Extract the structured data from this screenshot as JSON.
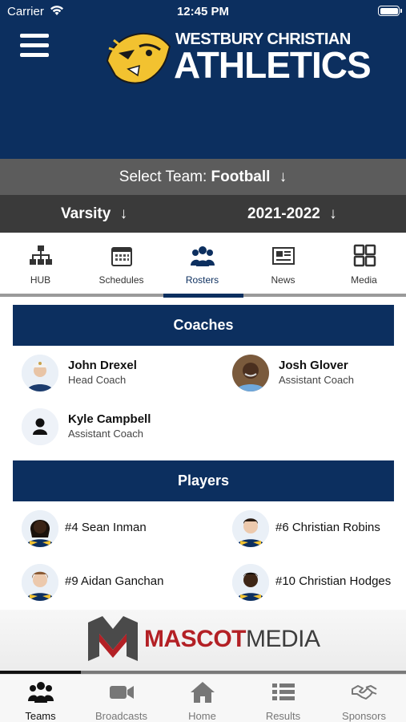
{
  "status_bar": {
    "carrier": "Carrier",
    "time": "12:45 PM"
  },
  "brand": {
    "line1": "WESTBURY CHRISTIAN",
    "line2": "ATHLETICS"
  },
  "team_select": {
    "label": "Select Team:",
    "value": "Football",
    "arrow": "↓"
  },
  "level_select": {
    "level": "Varsity",
    "season": "2021-2022",
    "arrow": "↓"
  },
  "subnav": {
    "active": "Rosters",
    "items": [
      {
        "label": "HUB",
        "icon": "org-chart-icon"
      },
      {
        "label": "Schedules",
        "icon": "calendar-icon"
      },
      {
        "label": "Rosters",
        "icon": "people-group-icon"
      },
      {
        "label": "News",
        "icon": "newspaper-icon"
      },
      {
        "label": "Media",
        "icon": "grid-icon"
      }
    ]
  },
  "coaches": {
    "heading": "Coaches",
    "items": [
      {
        "name": "John  Drexel",
        "title": "Head Coach"
      },
      {
        "name": "Josh  Glover",
        "title": "Assistant Coach"
      },
      {
        "name": "Kyle  Campbell",
        "title": "Assistant Coach"
      }
    ]
  },
  "players": {
    "heading": "Players",
    "items": [
      {
        "name": "#4 Sean Inman"
      },
      {
        "name": "#6 Christian Robins"
      },
      {
        "name": "#9 Aidan Ganchan"
      },
      {
        "name": "#10 Christian Hodges"
      }
    ]
  },
  "sponsor": {
    "part1": "MASCOT",
    "part2": "MEDIA",
    "progress": 0.2
  },
  "tabbar": {
    "active": "Teams",
    "items": [
      {
        "label": "Teams",
        "icon": "team-icon"
      },
      {
        "label": "Broadcasts",
        "icon": "video-camera-icon"
      },
      {
        "label": "Home",
        "icon": "home-icon"
      },
      {
        "label": "Results",
        "icon": "list-icon"
      },
      {
        "label": "Sponsors",
        "icon": "handshake-icon"
      }
    ]
  },
  "colors": {
    "navy": "#0c2f5f",
    "gold": "#f2c230",
    "sponsor_red": "#b32025"
  }
}
